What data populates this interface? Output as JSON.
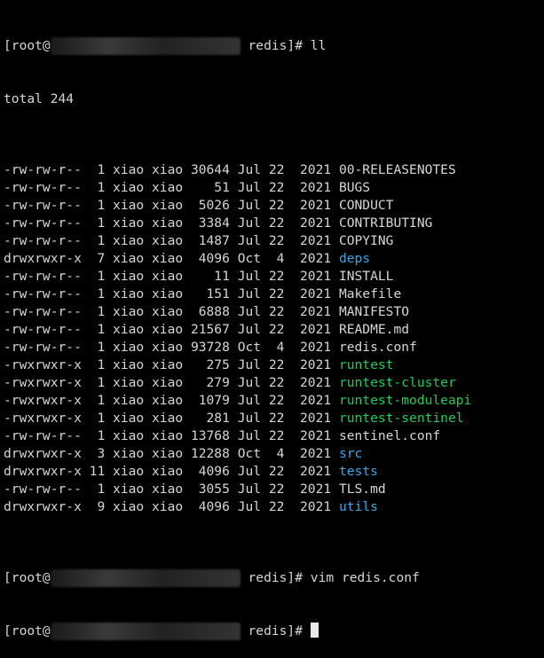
{
  "colors": {
    "background": "#000000",
    "text": "#d6d6d6",
    "directory": "#3aa6e6",
    "executable": "#22c95a"
  },
  "prompts": [
    {
      "user_host_prefix": "[root@",
      "dir": " redis]# ",
      "command": "ll"
    },
    {
      "user_host_prefix": "[root@",
      "dir": " redis]# ",
      "command": "vim redis.conf"
    },
    {
      "user_host_prefix": "[root@",
      "dir": " redis]# ",
      "command": ""
    }
  ],
  "total": "total 244",
  "entries": [
    {
      "perms": "-rw-rw-r--",
      "links": " 1",
      "owner": "xiao",
      "group": "xiao",
      "size": "30644",
      "month": "Jul",
      "day": "22",
      "year": "2021",
      "name": "00-RELEASENOTES",
      "type": "file"
    },
    {
      "perms": "-rw-rw-r--",
      "links": " 1",
      "owner": "xiao",
      "group": "xiao",
      "size": "   51",
      "month": "Jul",
      "day": "22",
      "year": "2021",
      "name": "BUGS",
      "type": "file"
    },
    {
      "perms": "-rw-rw-r--",
      "links": " 1",
      "owner": "xiao",
      "group": "xiao",
      "size": " 5026",
      "month": "Jul",
      "day": "22",
      "year": "2021",
      "name": "CONDUCT",
      "type": "file"
    },
    {
      "perms": "-rw-rw-r--",
      "links": " 1",
      "owner": "xiao",
      "group": "xiao",
      "size": " 3384",
      "month": "Jul",
      "day": "22",
      "year": "2021",
      "name": "CONTRIBUTING",
      "type": "file"
    },
    {
      "perms": "-rw-rw-r--",
      "links": " 1",
      "owner": "xiao",
      "group": "xiao",
      "size": " 1487",
      "month": "Jul",
      "day": "22",
      "year": "2021",
      "name": "COPYING",
      "type": "file"
    },
    {
      "perms": "drwxrwxr-x",
      "links": " 7",
      "owner": "xiao",
      "group": "xiao",
      "size": " 4096",
      "month": "Oct",
      "day": " 4",
      "year": "2021",
      "name": "deps",
      "type": "dir"
    },
    {
      "perms": "-rw-rw-r--",
      "links": " 1",
      "owner": "xiao",
      "group": "xiao",
      "size": "   11",
      "month": "Jul",
      "day": "22",
      "year": "2021",
      "name": "INSTALL",
      "type": "file"
    },
    {
      "perms": "-rw-rw-r--",
      "links": " 1",
      "owner": "xiao",
      "group": "xiao",
      "size": "  151",
      "month": "Jul",
      "day": "22",
      "year": "2021",
      "name": "Makefile",
      "type": "file"
    },
    {
      "perms": "-rw-rw-r--",
      "links": " 1",
      "owner": "xiao",
      "group": "xiao",
      "size": " 6888",
      "month": "Jul",
      "day": "22",
      "year": "2021",
      "name": "MANIFESTO",
      "type": "file"
    },
    {
      "perms": "-rw-rw-r--",
      "links": " 1",
      "owner": "xiao",
      "group": "xiao",
      "size": "21567",
      "month": "Jul",
      "day": "22",
      "year": "2021",
      "name": "README.md",
      "type": "file"
    },
    {
      "perms": "-rw-rw-r--",
      "links": " 1",
      "owner": "xiao",
      "group": "xiao",
      "size": "93728",
      "month": "Oct",
      "day": " 4",
      "year": "2021",
      "name": "redis.conf",
      "type": "file"
    },
    {
      "perms": "-rwxrwxr-x",
      "links": " 1",
      "owner": "xiao",
      "group": "xiao",
      "size": "  275",
      "month": "Jul",
      "day": "22",
      "year": "2021",
      "name": "runtest",
      "type": "exec"
    },
    {
      "perms": "-rwxrwxr-x",
      "links": " 1",
      "owner": "xiao",
      "group": "xiao",
      "size": "  279",
      "month": "Jul",
      "day": "22",
      "year": "2021",
      "name": "runtest-cluster",
      "type": "exec"
    },
    {
      "perms": "-rwxrwxr-x",
      "links": " 1",
      "owner": "xiao",
      "group": "xiao",
      "size": " 1079",
      "month": "Jul",
      "day": "22",
      "year": "2021",
      "name": "runtest-moduleapi",
      "type": "exec"
    },
    {
      "perms": "-rwxrwxr-x",
      "links": " 1",
      "owner": "xiao",
      "group": "xiao",
      "size": "  281",
      "month": "Jul",
      "day": "22",
      "year": "2021",
      "name": "runtest-sentinel",
      "type": "exec"
    },
    {
      "perms": "-rw-rw-r--",
      "links": " 1",
      "owner": "xiao",
      "group": "xiao",
      "size": "13768",
      "month": "Jul",
      "day": "22",
      "year": "2021",
      "name": "sentinel.conf",
      "type": "file"
    },
    {
      "perms": "drwxrwxr-x",
      "links": " 3",
      "owner": "xiao",
      "group": "xiao",
      "size": "12288",
      "month": "Oct",
      "day": " 4",
      "year": "2021",
      "name": "src",
      "type": "dir"
    },
    {
      "perms": "drwxrwxr-x",
      "links": "11",
      "owner": "xiao",
      "group": "xiao",
      "size": " 4096",
      "month": "Jul",
      "day": "22",
      "year": "2021",
      "name": "tests",
      "type": "dir"
    },
    {
      "perms": "-rw-rw-r--",
      "links": " 1",
      "owner": "xiao",
      "group": "xiao",
      "size": " 3055",
      "month": "Jul",
      "day": "22",
      "year": "2021",
      "name": "TLS.md",
      "type": "file"
    },
    {
      "perms": "drwxrwxr-x",
      "links": " 9",
      "owner": "xiao",
      "group": "xiao",
      "size": " 4096",
      "month": "Jul",
      "day": "22",
      "year": "2021",
      "name": "utils",
      "type": "dir"
    }
  ]
}
